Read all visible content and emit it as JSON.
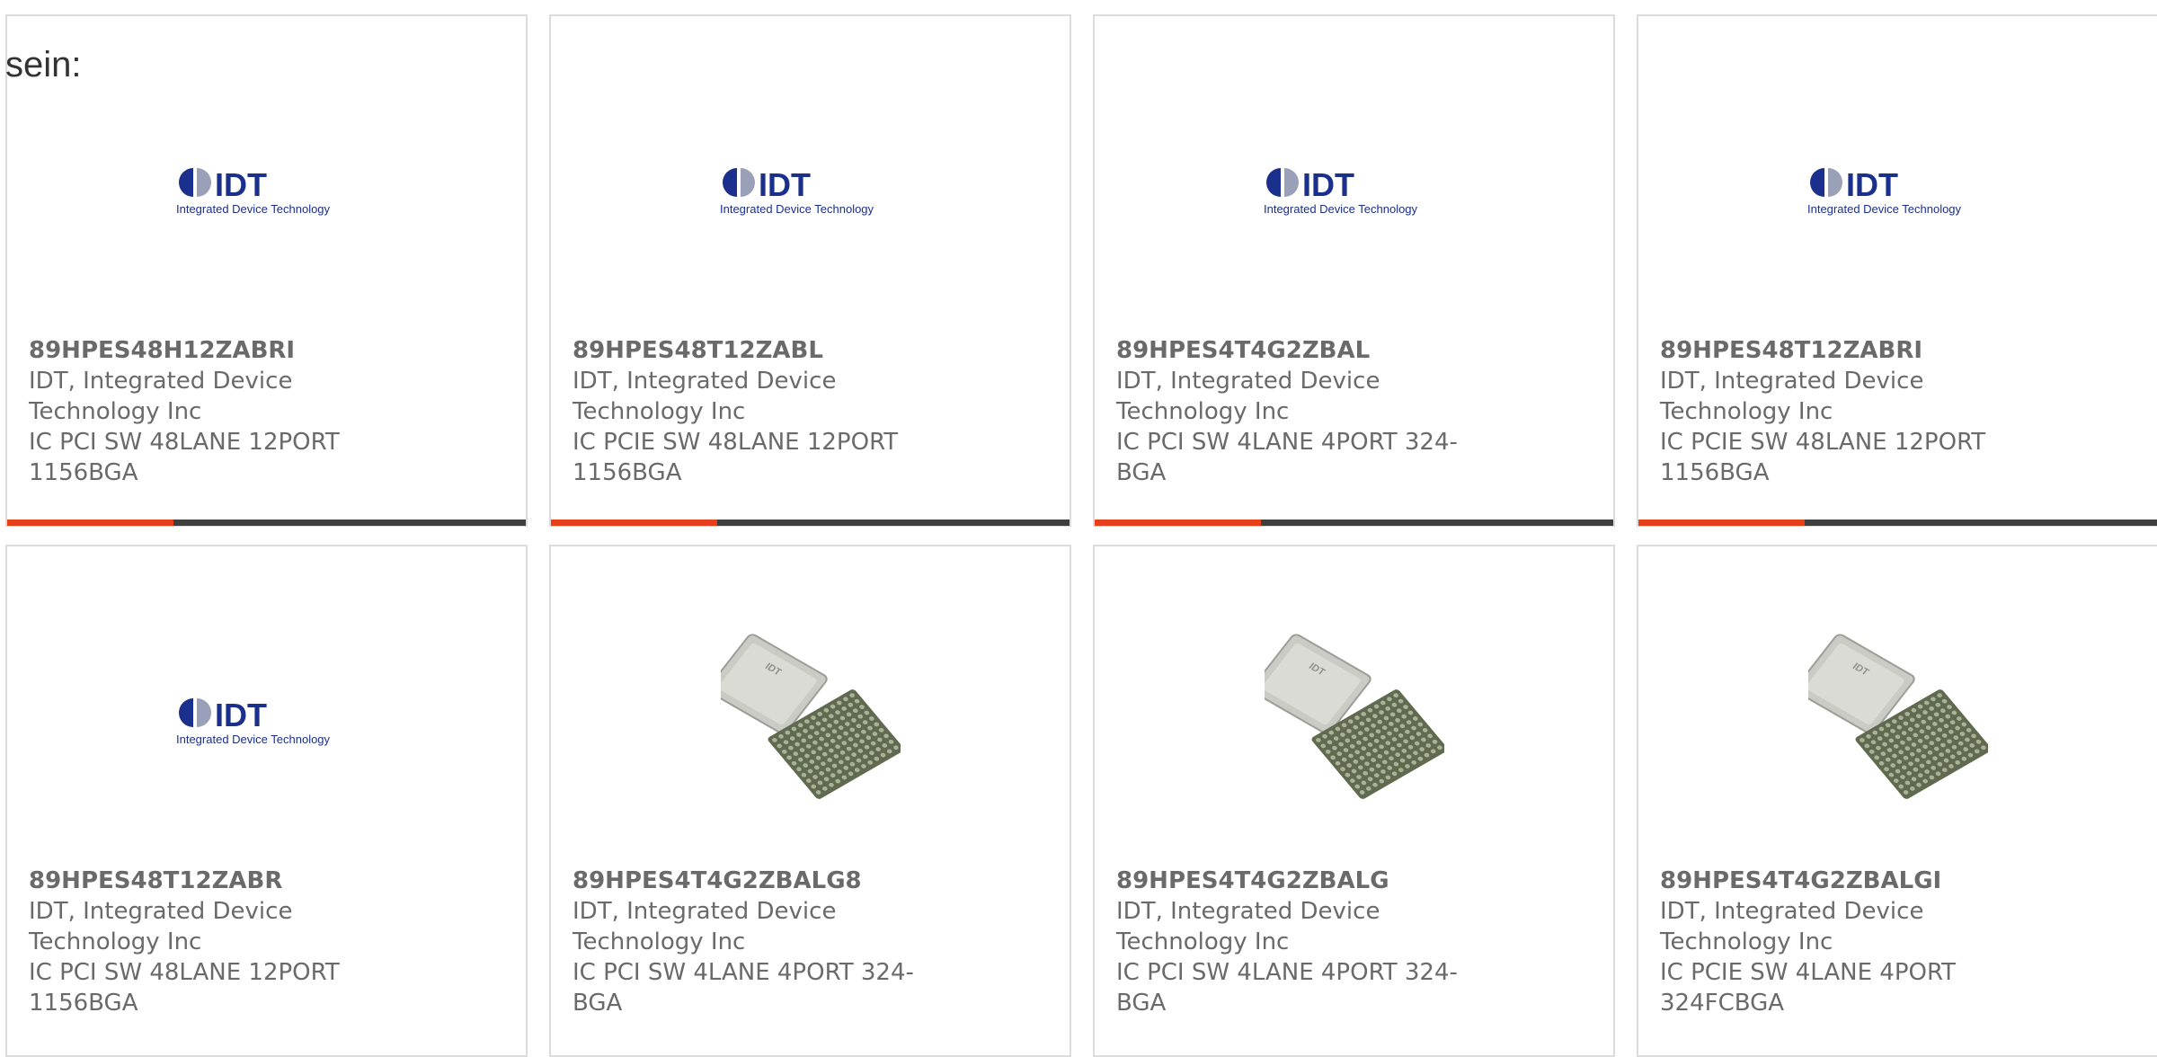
{
  "intro": {
    "text": "sein:"
  },
  "logo_text": {
    "brand": "IDT",
    "tagline": "Integrated Device Technology"
  },
  "chip_marking": "IDT",
  "colors": {
    "accent": "#e6401b",
    "bar_track": "#3e3e3e",
    "card_border": "#dcdcdc",
    "text": "#6a6a6a",
    "logo_blue": "#1b2f8c"
  },
  "products": [
    {
      "part_number": "89HPES48H12ZABRI",
      "manufacturer": "IDT, Integrated Device Technology Inc",
      "description": "IC PCI SW 48LANE 12PORT 1156BGA",
      "image": "idt-logo",
      "progress": 0.32
    },
    {
      "part_number": "89HPES48T12ZABL",
      "manufacturer": "IDT, Integrated Device Technology Inc",
      "description": "IC PCIE SW 48LANE 12PORT 1156BGA",
      "image": "idt-logo",
      "progress": 0.32
    },
    {
      "part_number": "89HPES4T4G2ZBAL",
      "manufacturer": "IDT, Integrated Device Technology Inc",
      "description": "IC PCI SW 4LANE 4PORT 324-BGA",
      "image": "idt-logo",
      "progress": 0.32
    },
    {
      "part_number": "89HPES48T12ZABRI",
      "manufacturer": "IDT, Integrated Device Technology Inc",
      "description": "IC PCIE SW 48LANE 12PORT 1156BGA",
      "image": "idt-logo",
      "progress": 0.32
    },
    {
      "part_number": "89HPES48T12ZABR",
      "manufacturer": "IDT, Integrated Device Technology Inc",
      "description": "IC PCI SW 48LANE 12PORT 1156BGA",
      "image": "idt-logo",
      "progress": 0
    },
    {
      "part_number": "89HPES4T4G2ZBALG8",
      "manufacturer": "IDT, Integrated Device Technology Inc",
      "description": "IC PCI SW 4LANE 4PORT 324-BGA",
      "image": "bga-chip",
      "progress": 0
    },
    {
      "part_number": "89HPES4T4G2ZBALG",
      "manufacturer": "IDT, Integrated Device Technology Inc",
      "description": "IC PCI SW 4LANE 4PORT 324-BGA",
      "image": "bga-chip",
      "progress": 0
    },
    {
      "part_number": "89HPES4T4G2ZBALGI",
      "manufacturer": "IDT, Integrated Device Technology Inc",
      "description": "IC PCIE SW 4LANE 4PORT 324FCBGA",
      "image": "bga-chip",
      "progress": 0
    }
  ]
}
